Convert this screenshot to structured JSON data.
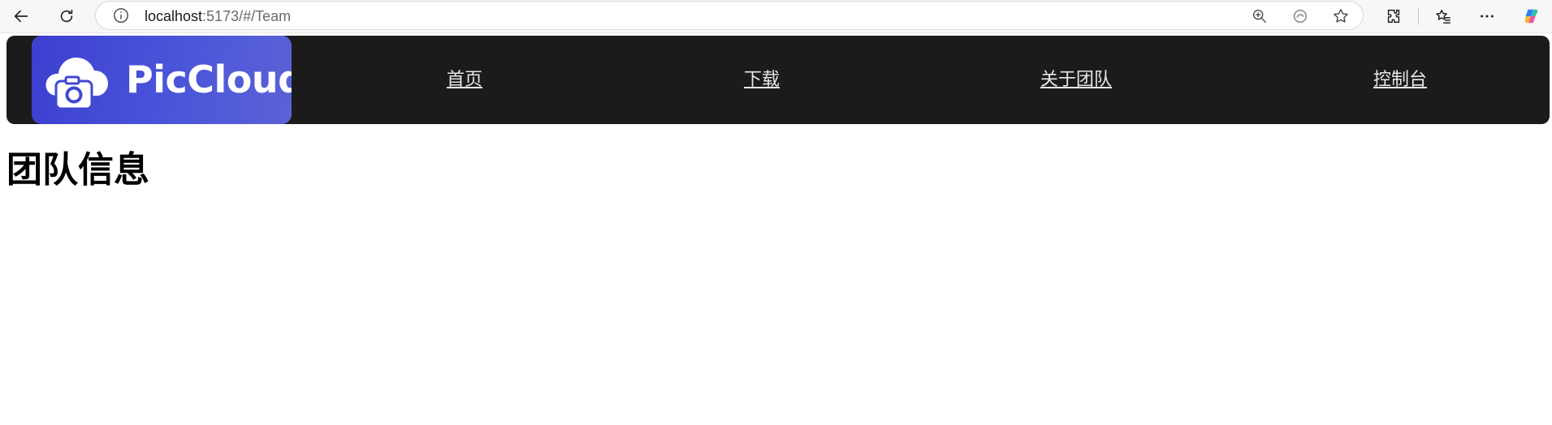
{
  "browser": {
    "url_host": "localhost",
    "url_path": ":5173/#/Team",
    "icons": [
      "back-arrow-icon",
      "refresh-icon",
      "info-icon",
      "zoom-icon",
      "read-aloud-icon",
      "favorite-star-icon",
      "extensions-icon",
      "favorites-icon",
      "more-icon",
      "copilot-icon"
    ]
  },
  "header": {
    "logo_text": "PicCloud",
    "logo_colors": {
      "start": "#3c3fd0",
      "end": "#5b62d6"
    },
    "nav": [
      {
        "label": "首页"
      },
      {
        "label": "下载"
      },
      {
        "label": "关于团队"
      },
      {
        "label": "控制台"
      }
    ]
  },
  "main": {
    "title": "团队信息"
  }
}
